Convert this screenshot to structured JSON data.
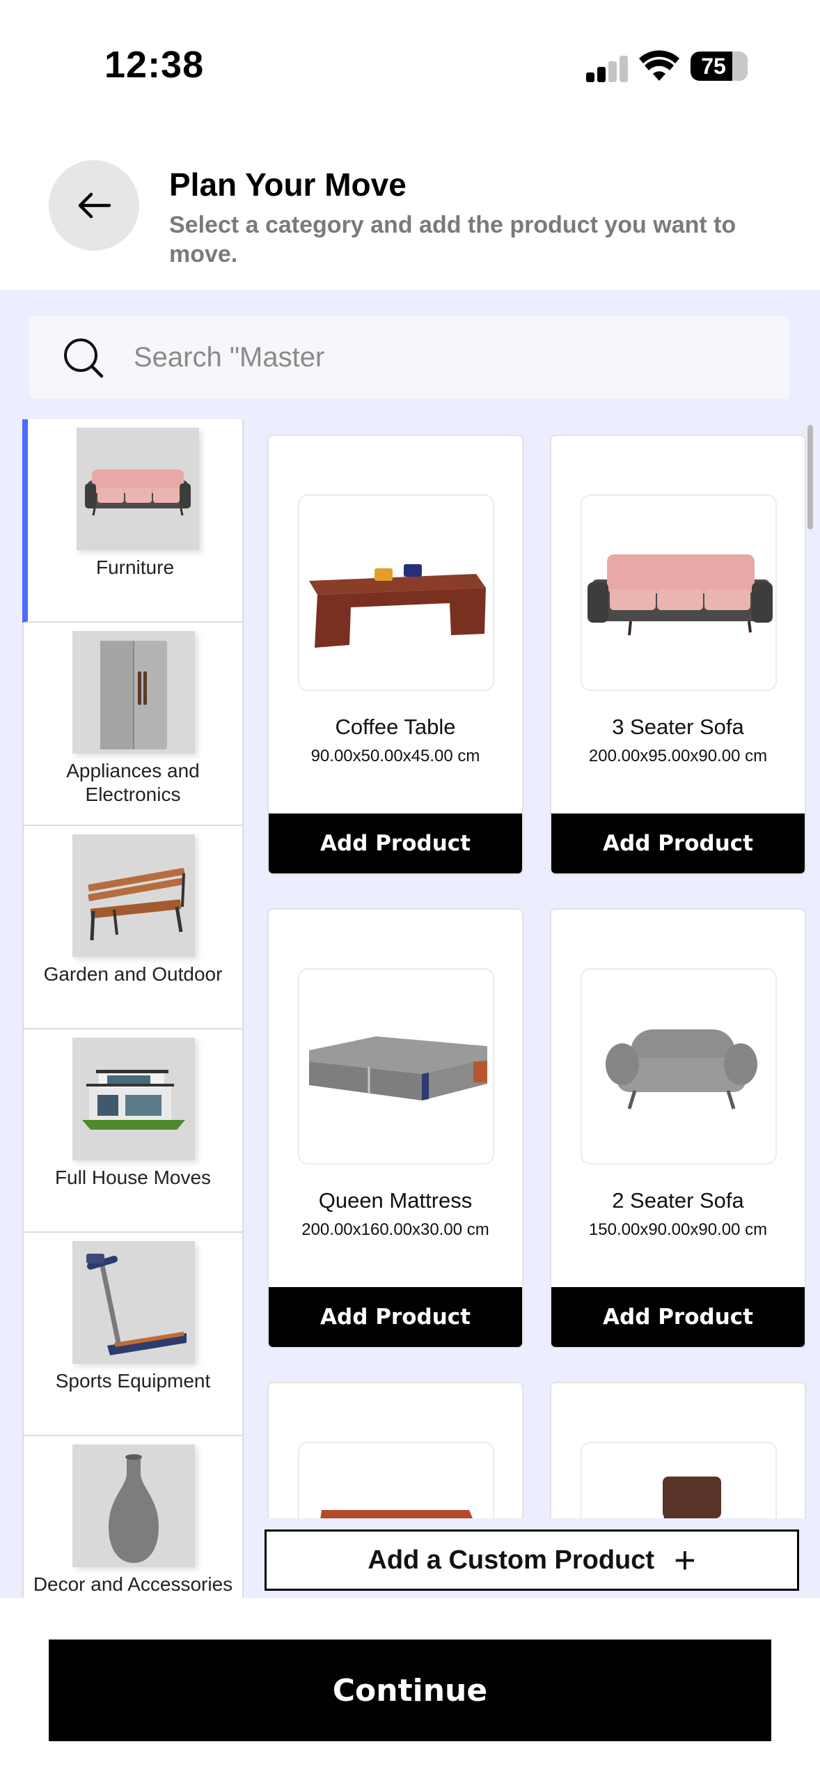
{
  "status_bar": {
    "time": "12:38",
    "battery": "75"
  },
  "header": {
    "title": "Plan Your Move",
    "subtitle": "Select a category and add the product you want to move."
  },
  "search": {
    "placeholder": "Search \"Master"
  },
  "categories": [
    {
      "label": "Furniture",
      "icon": "sofa-icon",
      "active": true
    },
    {
      "label": "Appliances and Electronics",
      "icon": "fridge-icon"
    },
    {
      "label": "Garden and Outdoor",
      "icon": "bench-icon"
    },
    {
      "label": "Full House Moves",
      "icon": "house-icon"
    },
    {
      "label": "Sports Equipment",
      "icon": "treadmill-icon"
    },
    {
      "label": "Decor and Accessories",
      "icon": "vase-icon"
    }
  ],
  "products": [
    {
      "name": "Coffee Table",
      "dims": "90.00x50.00x45.00 cm",
      "button": "Add Product",
      "icon": "coffee-table-icon"
    },
    {
      "name": "3 Seater Sofa",
      "dims": "200.00x95.00x90.00 cm",
      "button": "Add Product",
      "icon": "sofa-icon"
    },
    {
      "name": "Queen Mattress",
      "dims": "200.00x160.00x30.00 cm",
      "button": "Add Product",
      "icon": "mattress-icon"
    },
    {
      "name": "2 Seater Sofa",
      "dims": "150.00x90.00x90.00 cm",
      "button": "Add Product",
      "icon": "armchair-icon"
    },
    {
      "icon": "side-table-icon"
    },
    {
      "icon": "chair-icon"
    }
  ],
  "custom_product": {
    "label": "Add a Custom Product",
    "icon": "plus-icon"
  },
  "footer": {
    "continue_label": "Continue"
  },
  "colors": {
    "accent": "#4a6bff",
    "background": "#eceeff",
    "button": "#000000"
  }
}
